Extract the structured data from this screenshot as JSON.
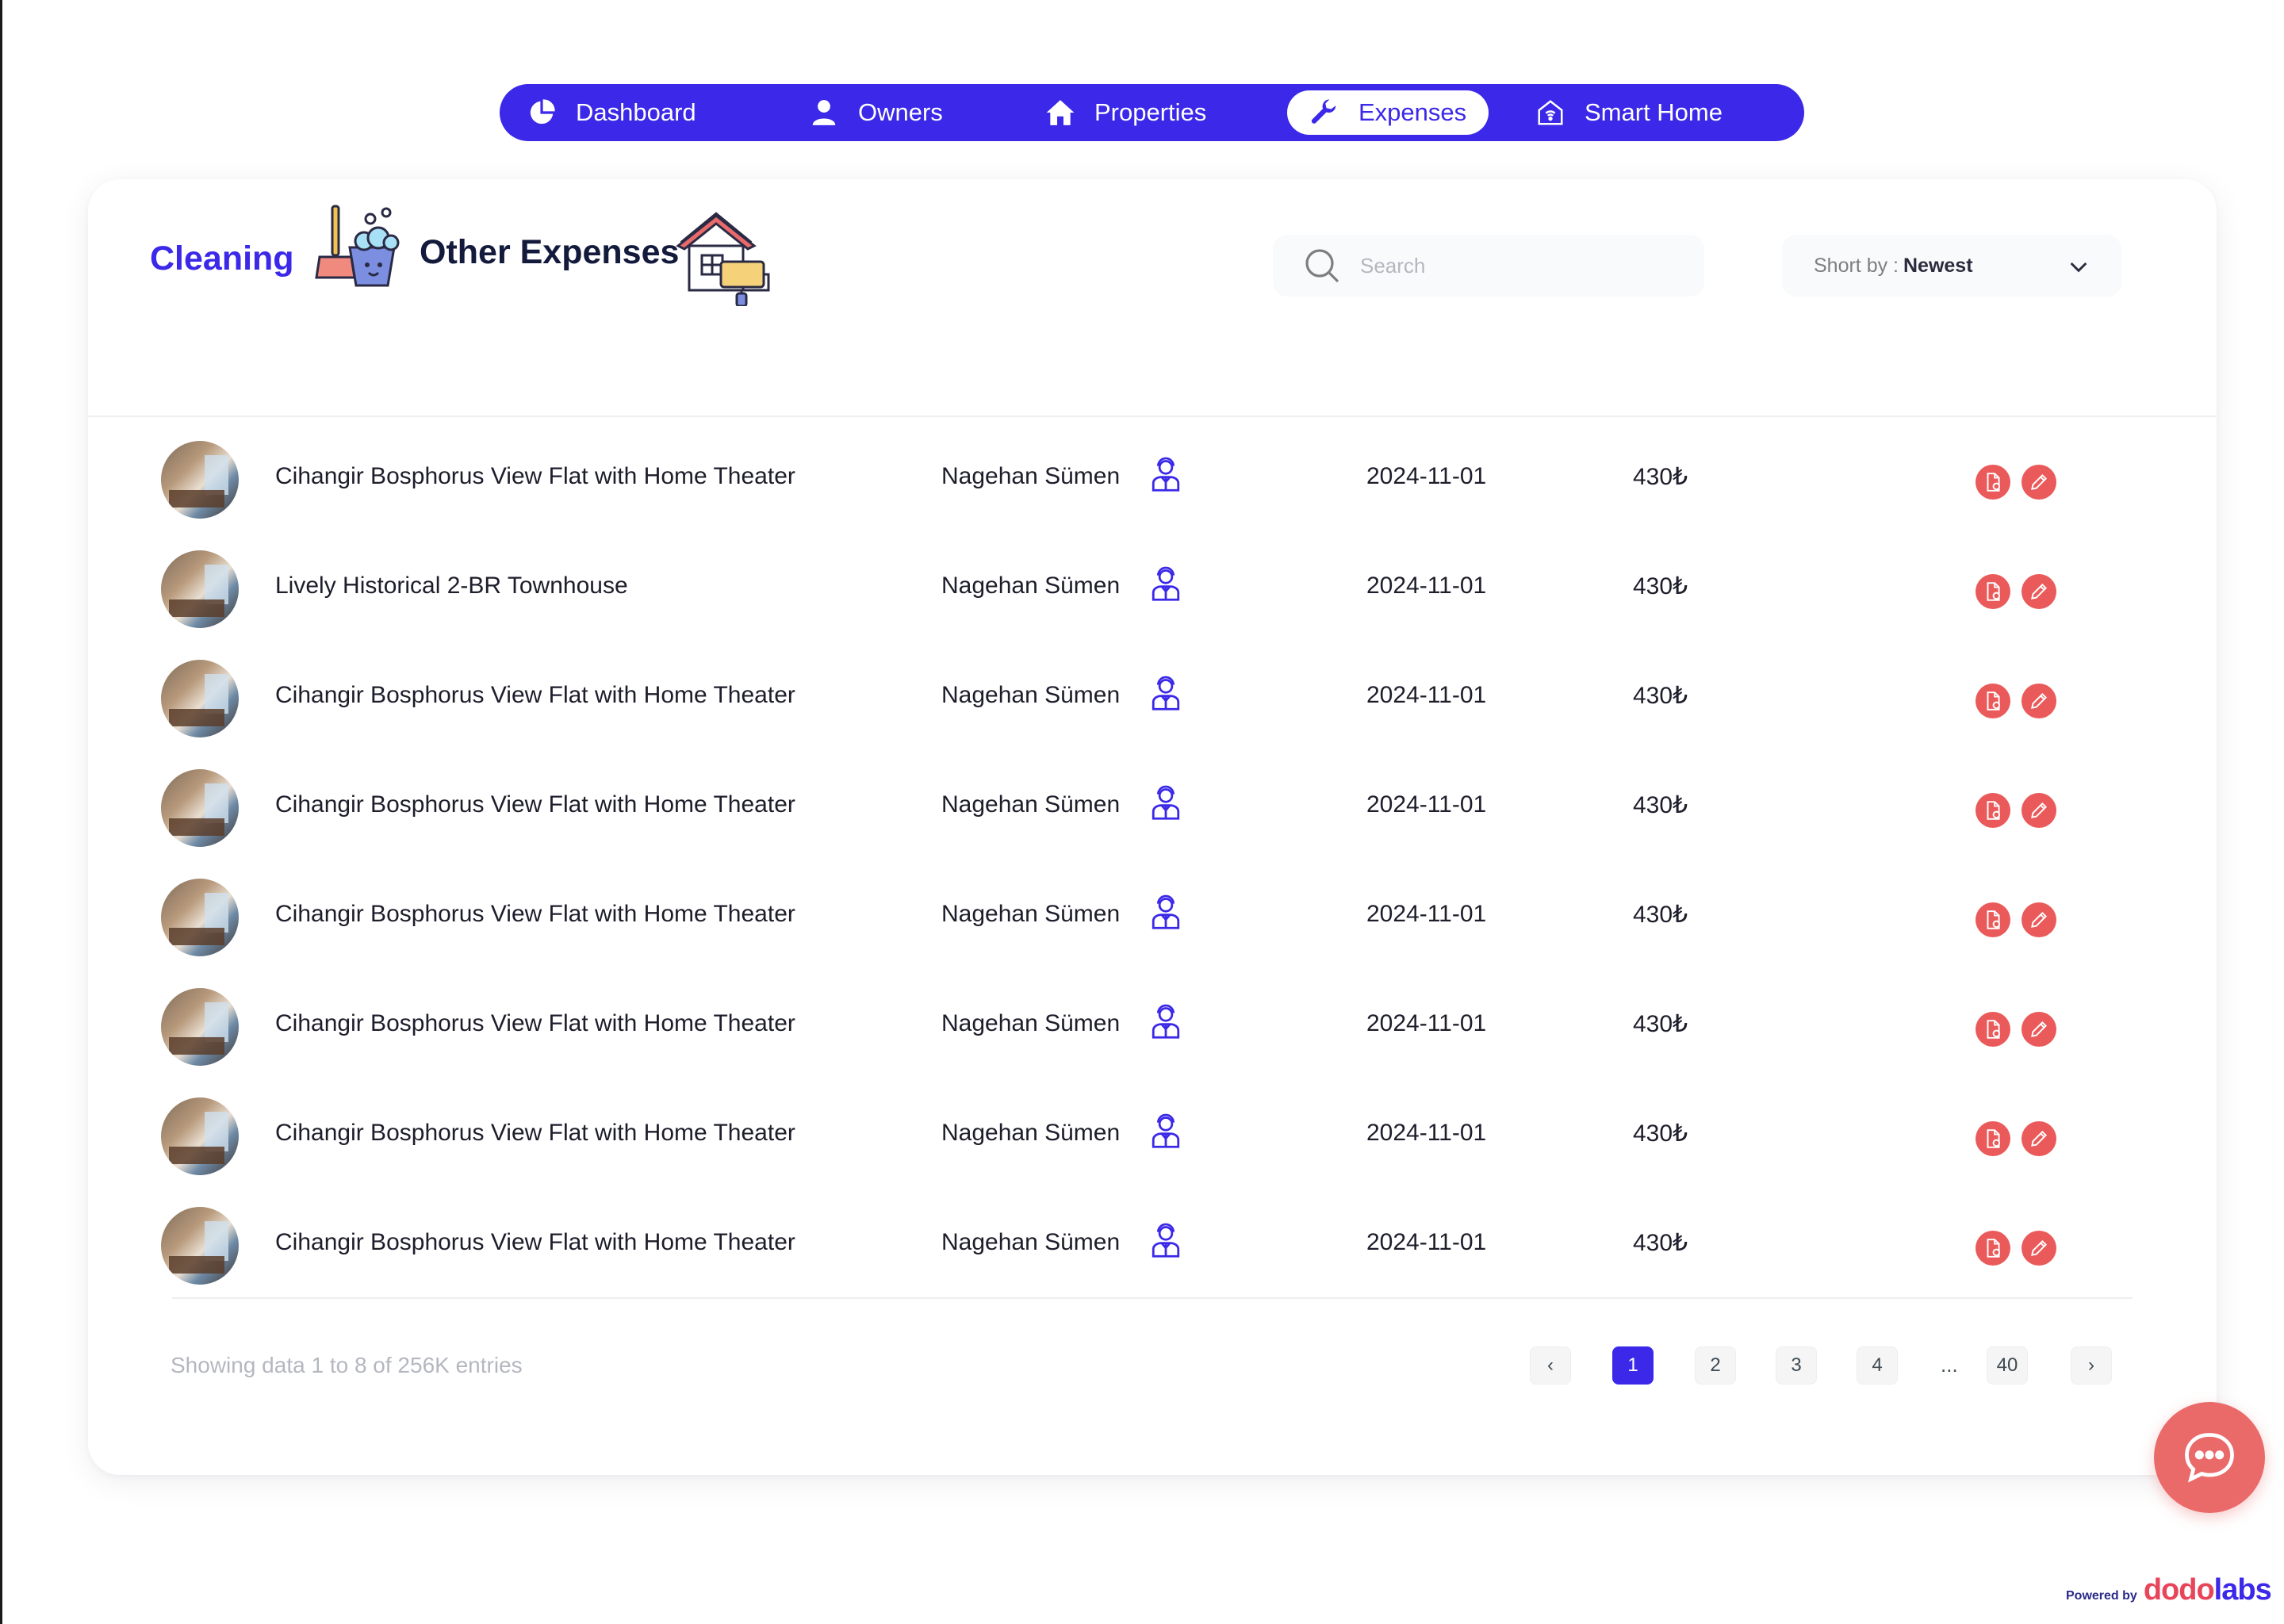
{
  "nav": {
    "items": [
      {
        "label": "Dashboard",
        "icon": "pie-chart-icon",
        "active": false
      },
      {
        "label": "Owners",
        "icon": "user-icon",
        "active": false
      },
      {
        "label": "Properties",
        "icon": "home-icon",
        "active": false
      },
      {
        "label": "Expenses",
        "icon": "wrench-icon",
        "active": true
      },
      {
        "label": "Smart Home",
        "icon": "smart-home-icon",
        "active": false
      }
    ]
  },
  "tabs": {
    "cleaning": "Cleaning",
    "other": "Other Expenses"
  },
  "search": {
    "placeholder": "Search"
  },
  "sort": {
    "label": "Short by :",
    "value": "Newest"
  },
  "rows": [
    {
      "property": "Cihangir Bosphorus View Flat with Home Theater",
      "owner": "Nagehan Sümen",
      "date": "2024-11-01",
      "amount": "430₺"
    },
    {
      "property": "Lively Historical 2-BR Townhouse",
      "owner": "Nagehan Sümen",
      "date": "2024-11-01",
      "amount": "430₺"
    },
    {
      "property": "Cihangir Bosphorus View Flat with Home Theater",
      "owner": "Nagehan Sümen",
      "date": "2024-11-01",
      "amount": "430₺"
    },
    {
      "property": "Cihangir Bosphorus View Flat with Home Theater",
      "owner": "Nagehan Sümen",
      "date": "2024-11-01",
      "amount": "430₺"
    },
    {
      "property": "Cihangir Bosphorus View Flat with Home Theater",
      "owner": "Nagehan Sümen",
      "date": "2024-11-01",
      "amount": "430₺"
    },
    {
      "property": "Cihangir Bosphorus View Flat with Home Theater",
      "owner": "Nagehan Sümen",
      "date": "2024-11-01",
      "amount": "430₺"
    },
    {
      "property": "Cihangir Bosphorus View Flat with Home Theater",
      "owner": "Nagehan Sümen",
      "date": "2024-11-01",
      "amount": "430₺"
    },
    {
      "property": "Cihangir Bosphorus View Flat with Home Theater",
      "owner": "Nagehan Sümen",
      "date": "2024-11-01",
      "amount": "430₺"
    }
  ],
  "footer": {
    "showing": "Showing data 1 to 8 of  256K entries"
  },
  "pagination": {
    "prev": "‹",
    "pages": [
      "1",
      "2",
      "3",
      "4"
    ],
    "ellipsis": "...",
    "last": "40",
    "next": "›",
    "current": "1"
  },
  "powered": {
    "prefix": "Powered by",
    "brand_a": "dodo",
    "brand_b": "labs"
  },
  "colors": {
    "accent": "#3b28e8",
    "danger": "#ea5a5a",
    "muted": "#b5b7c0"
  }
}
